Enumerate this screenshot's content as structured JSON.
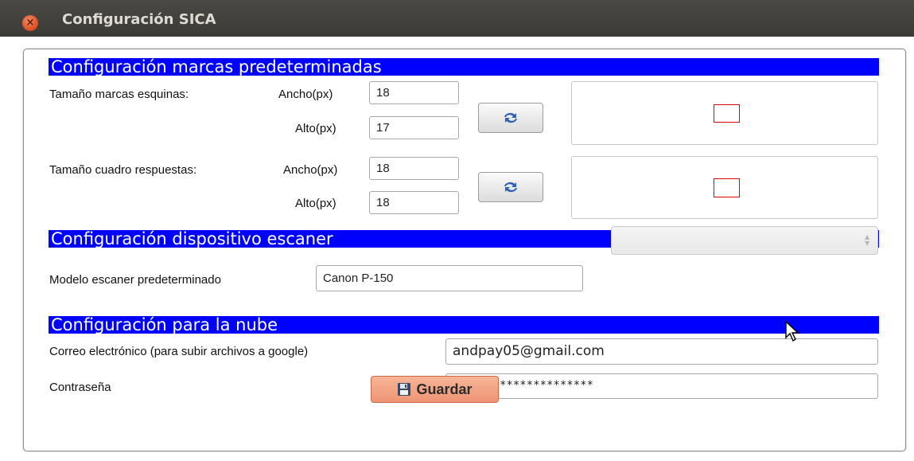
{
  "window": {
    "title": "Configuración SICA",
    "close_glyph": "×"
  },
  "sections": {
    "marks": "Configuración marcas predeterminadas",
    "scanner": "Configuración dispositivo escaner",
    "cloud": "Configuración para la nube"
  },
  "corner_marks": {
    "label": "Tamaño marcas esquinas:",
    "width_label": "Ancho(px)",
    "width_value": "18",
    "height_label": "Alto(px)",
    "height_value": "17",
    "refresh_icon": "refresh-icon"
  },
  "answer_box": {
    "label": "Tamaño cuadro respuestas:",
    "width_label": "Ancho(px)",
    "width_value": "18",
    "height_label": "Alto(px)",
    "height_value": "18",
    "refresh_icon": "refresh-icon"
  },
  "scanner": {
    "label": "Modelo escaner predeterminado",
    "model_value": "Canon P-150",
    "select_value": ""
  },
  "cloud": {
    "email_label": "Correo electrónico (para subir archivos a google)",
    "email_value": "andpay05@gmail.com",
    "password_label": "Contraseña",
    "password_value": "*********************"
  },
  "actions": {
    "save_label": "Guardar",
    "save_icon": "floppy-disk-icon"
  },
  "colors": {
    "section_header_bg": "#0000ff",
    "preview_mark": "#e00000",
    "save_button": "#f19f7e",
    "titlebar": "#3c3b37"
  }
}
